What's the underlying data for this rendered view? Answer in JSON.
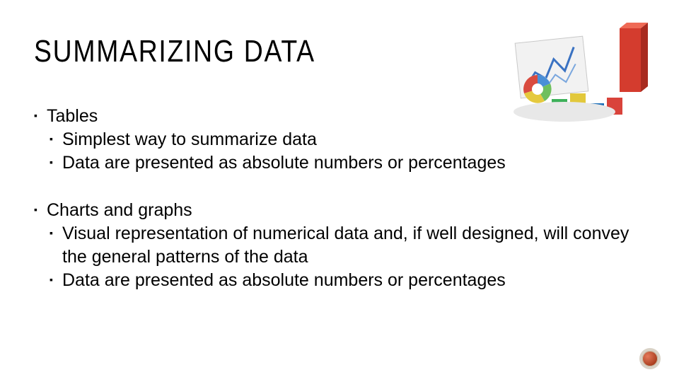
{
  "title": "SUMMARIZING DATA",
  "groups": [
    {
      "heading": "Tables",
      "items": [
        "Simplest way to summarize data",
        "Data are presented as absolute numbers or percentages"
      ]
    },
    {
      "heading": "Charts and graphs",
      "items": [
        "Visual representation of numerical data and, if well designed, will convey the general patterns of the data",
        "Data are presented as absolute numbers or percentages"
      ]
    }
  ]
}
